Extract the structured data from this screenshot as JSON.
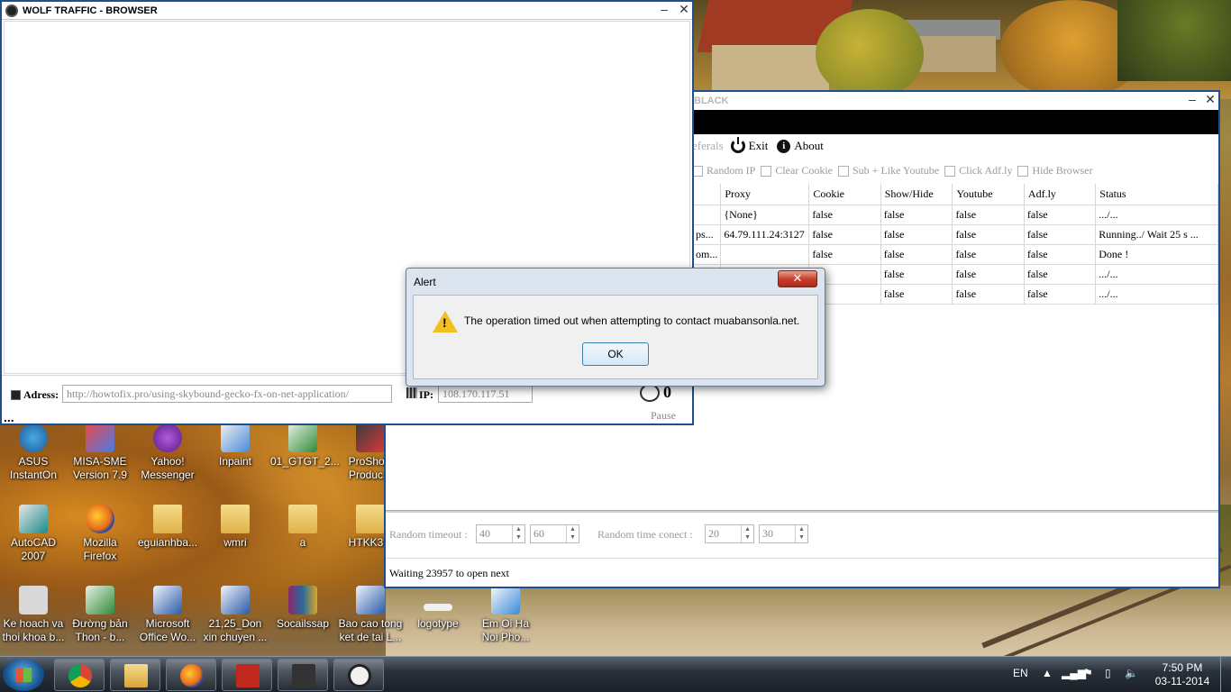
{
  "browser": {
    "title": "WOLF TRAFFIC - BROWSER",
    "address_label": "Adress:",
    "address_value": "http://howtofix.pro/using-skybound-gecko-fx-on-net-application/",
    "ip_label": "IP:",
    "ip_value": "108.170.117.51",
    "timer_value": "0",
    "pause_label": "Pause",
    "dots": "..."
  },
  "main": {
    "title_fragment": "BLACK",
    "menu": {
      "referals": "eferals",
      "exit": "Exit",
      "about": "About"
    },
    "options": [
      "Random IP",
      "Clear Cookie",
      "Sub + Like Youtube",
      "Click Adf.ly",
      "Hide Browser"
    ],
    "columns": [
      "",
      "Proxy",
      "Cookie",
      "Show/Hide",
      "Youtube",
      "Adf.ly",
      "Status"
    ],
    "rows": [
      [
        "",
        "{None}",
        "false",
        "false",
        "false",
        "false",
        ".../..."
      ],
      [
        "ps...",
        "64.79.111.24:3127",
        "false",
        "false",
        "false",
        "false",
        "Running../ Wait 25 s ..."
      ],
      [
        "om...",
        "",
        "false",
        "false",
        "false",
        "false",
        "Done !"
      ],
      [
        "",
        "",
        "lse",
        "false",
        "false",
        "false",
        ".../..."
      ],
      [
        "",
        "",
        "lse",
        "false",
        "false",
        "false",
        ".../..."
      ]
    ],
    "random_timeout_label": "Random timeout :",
    "random_timeout_min": "40",
    "random_timeout_max": "60",
    "random_connect_label": "Random time conect :",
    "random_connect_min": "20",
    "random_connect_max": "30",
    "status_text": "Waiting 23957 to open next"
  },
  "alert": {
    "title": "Alert",
    "message": "The operation timed out when attempting to contact muabansonla.net.",
    "ok_label": "OK",
    "close_glyph": "✕"
  },
  "desktop_icons": [
    {
      "label": "ASUS InstantOn",
      "icon": "asus-icon"
    },
    {
      "label": "MISA-SME Version 7.9",
      "icon": "misa-icon"
    },
    {
      "label": "Yahoo! Messenger",
      "icon": "yahoo-icon"
    },
    {
      "label": "Inpaint",
      "icon": "inpaint-icon"
    },
    {
      "label": "01_GTGT_2...",
      "icon": "excel-icon"
    },
    {
      "label": "ProShow Produc...",
      "icon": "proshow-icon"
    },
    {
      "label": "AutoCAD 2007",
      "icon": "autocad-icon"
    },
    {
      "label": "Mozilla Firefox",
      "icon": "firefox-icon"
    },
    {
      "label": "eguianhba...",
      "icon": "folder-icon"
    },
    {
      "label": "wmri",
      "icon": "folder-icon"
    },
    {
      "label": "a",
      "icon": "folder-icon"
    },
    {
      "label": "HTKK3...",
      "icon": "folder-icon"
    },
    {
      "label": "Ke hoach va thoi khoa b...",
      "icon": "file-icon"
    },
    {
      "label": "Đường bản Thon - b...",
      "icon": "excel-icon"
    },
    {
      "label": "Microsoft Office Wo...",
      "icon": "word-icon"
    },
    {
      "label": "21,25_Don xin chuyen ...",
      "icon": "word-icon"
    },
    {
      "label": "Socailssap",
      "icon": "rar-icon"
    },
    {
      "label": "Bao cao tong ket de tai L...",
      "icon": "word-icon"
    },
    {
      "label": "logotype",
      "icon": "image-icon"
    },
    {
      "label": "Em Oi Ha Noi Pho...",
      "icon": "mp3-icon"
    }
  ],
  "taskbar": {
    "language": "EN",
    "time": "7:50 PM",
    "date": "03-11-2014"
  }
}
